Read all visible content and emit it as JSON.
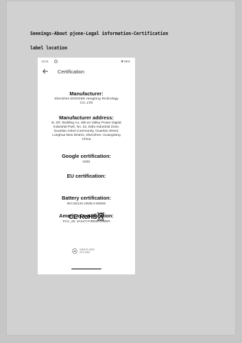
{
  "doc": {
    "caption_line1": "Seeeings-About pjone-Legal information-Certification",
    "caption_line2": "label location"
  },
  "statusbar": {
    "time": "13:21",
    "right": "✱ 66%"
  },
  "appbar": {
    "title": "Certification",
    "back_icon": "arrow-back-icon"
  },
  "sections": {
    "manufacturer_heading": "Manufacturer:",
    "manufacturer_line1": "Shenzhen DOOGEE Hengtong Technology",
    "manufacturer_line2": "CO.,LTD",
    "address_heading": "Manufacturer address:",
    "address_line1": "B, 2/F, Building A4, Silicon Valley Power Digital",
    "address_line2": "Industrial Park, No. 22, Dafu Industrial Zone,",
    "address_line3": "Guanlan Aobei Community, Guanlan Street,",
    "address_line4": "Longhua New District, Shenzhen, Guangdong",
    "address_line5": "China",
    "google_heading": "Google certification:",
    "google_value": "GMS",
    "eu_heading": "EU certification:",
    "eu_marks_text": "CE RoHS",
    "battery_heading": "Battery certification:",
    "battery_value": "IEC:62133 UN38.3 MSDS",
    "americas_heading": "Americas certification:",
    "americas_value": "FCC_ID: 2AX4Y-FIRE6POWER",
    "seal_line1": "CMIIT ID: 2023",
    "seal_line2": "CCC 2023"
  },
  "colors": {
    "background": "#c6c6c6",
    "page": "#d1d1d1",
    "screen": "#ffffff"
  }
}
